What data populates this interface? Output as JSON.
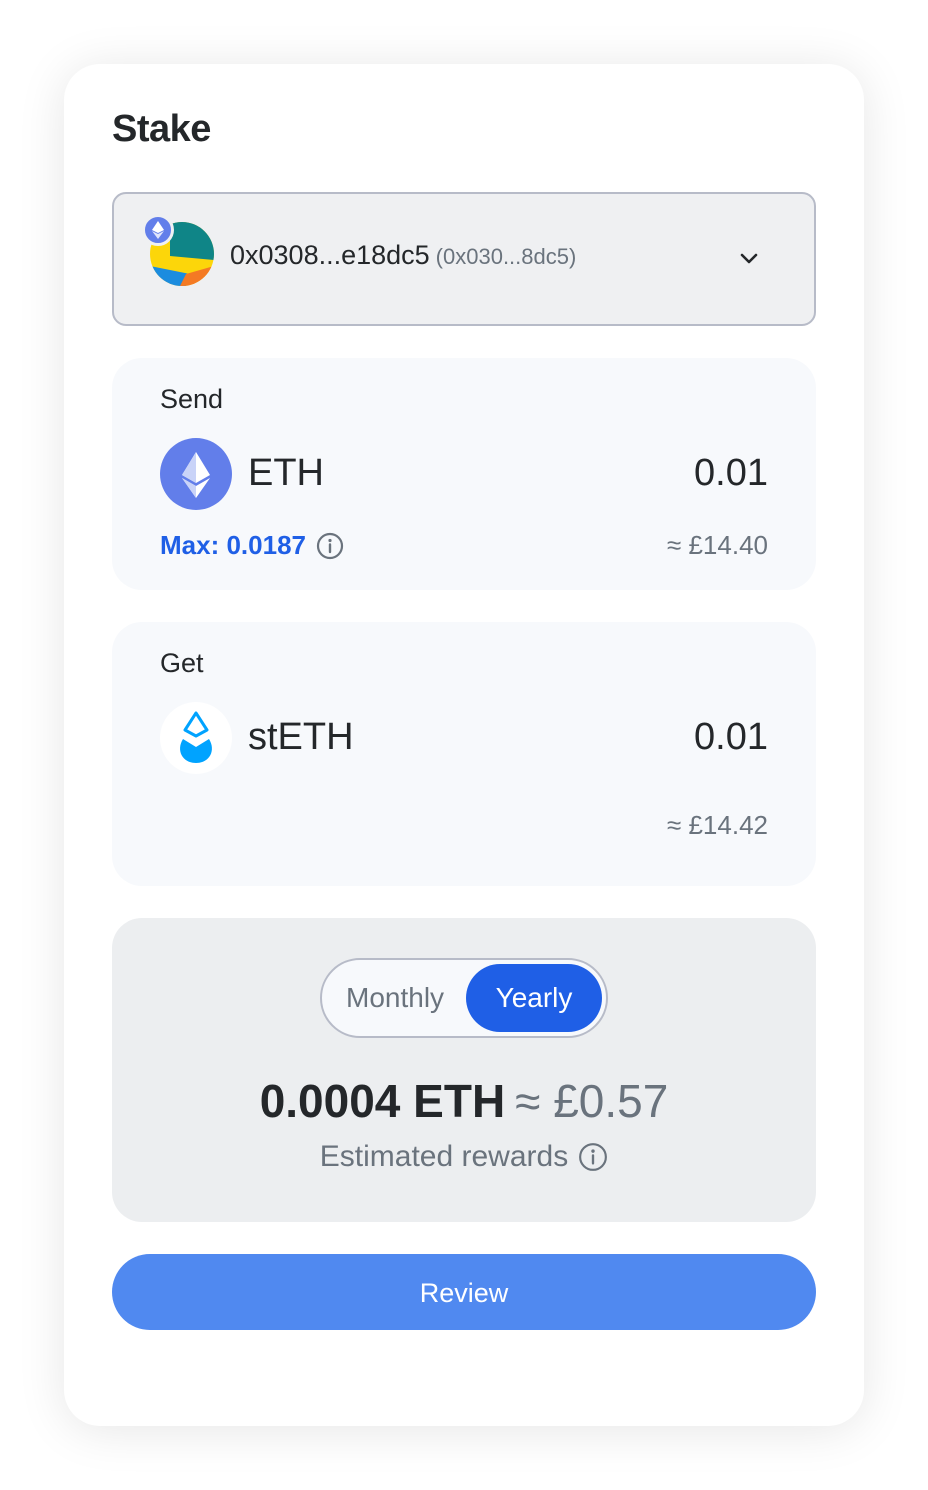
{
  "page": {
    "title": "Stake"
  },
  "account": {
    "name": "0x0308...e18dc5",
    "address_short": "(0x030...8dc5)",
    "avatar_icon": "jazzicon-avatar",
    "network_icon": "ethereum-icon"
  },
  "send": {
    "label": "Send",
    "token": "ETH",
    "amount": "0.01",
    "max_label": "Max: 0.0187",
    "fiat": "≈ £14.40"
  },
  "get": {
    "label": "Get",
    "token": "stETH",
    "amount": "0.01",
    "fiat": "≈ £14.42"
  },
  "rewards": {
    "toggle_monthly": "Monthly",
    "toggle_yearly": "Yearly",
    "selected": "Yearly",
    "value_eth": "0.0004 ETH",
    "value_fiat": "≈ £0.57",
    "label": "Estimated rewards"
  },
  "actions": {
    "review_label": "Review"
  },
  "colors": {
    "accent": "#1f5fe6",
    "button": "#5089f0",
    "eth": "#627eea",
    "steth": "#00a3ff"
  }
}
